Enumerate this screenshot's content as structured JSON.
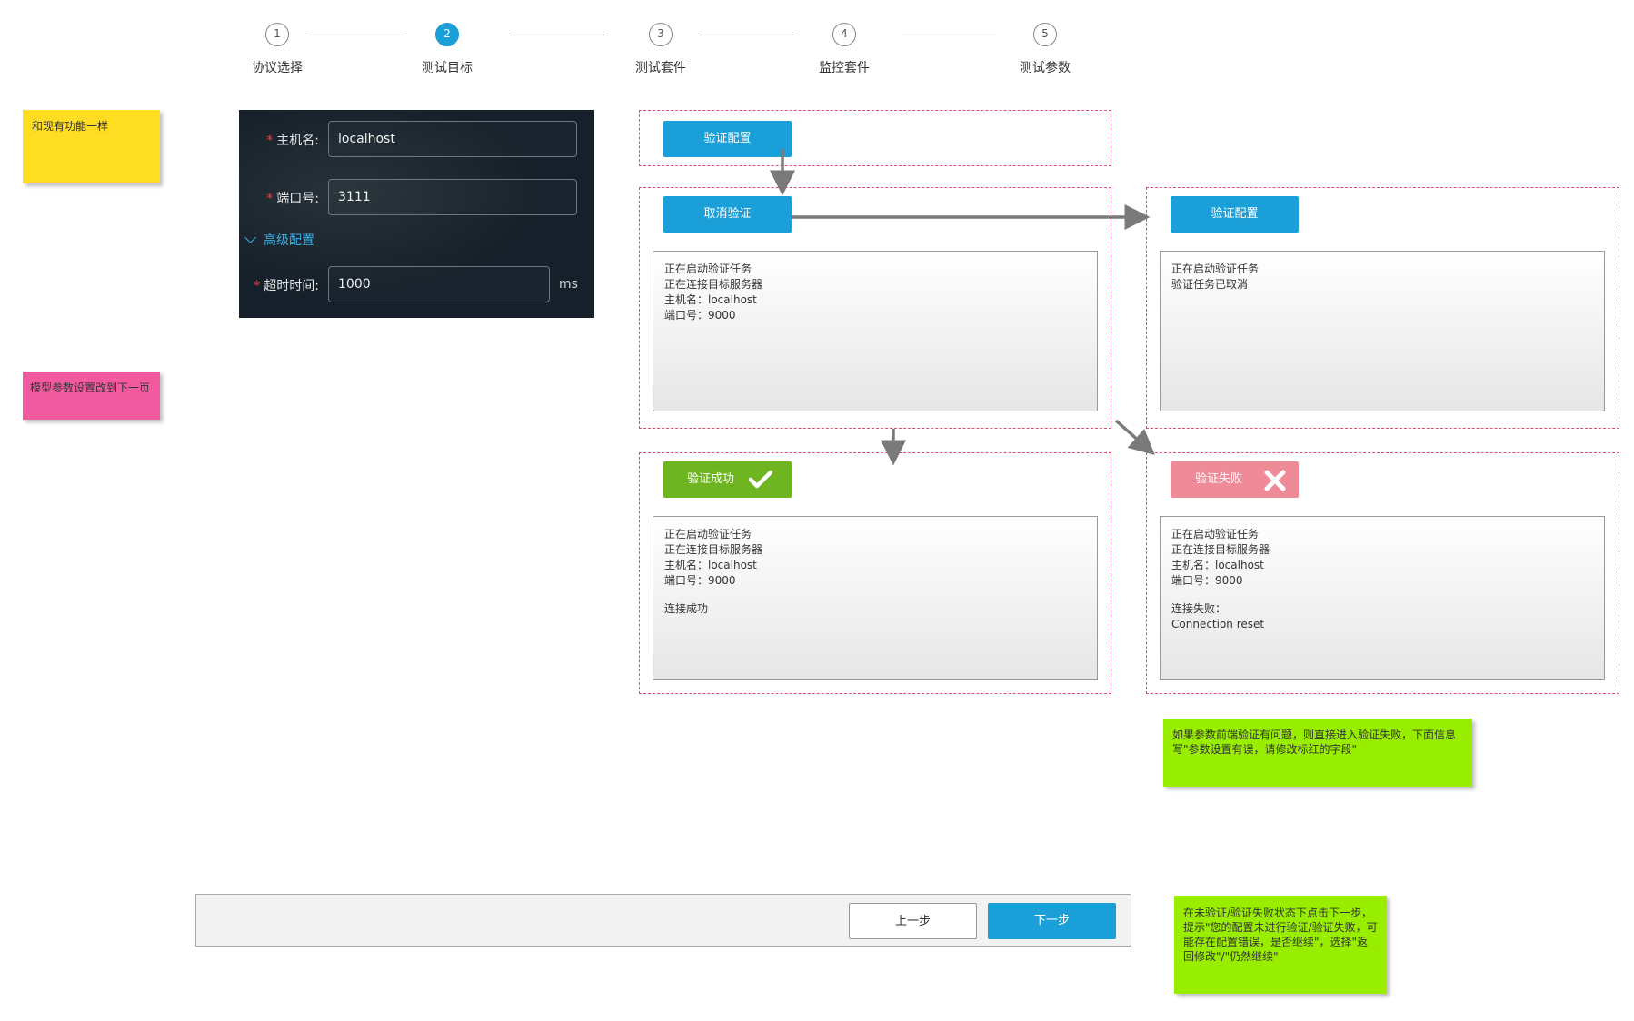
{
  "steps": [
    {
      "num": "1",
      "label": "协议选择",
      "active": false
    },
    {
      "num": "2",
      "label": "测试目标",
      "active": true
    },
    {
      "num": "3",
      "label": "测试套件",
      "active": false
    },
    {
      "num": "4",
      "label": "监控套件",
      "active": false
    },
    {
      "num": "5",
      "label": "测试参数",
      "active": false
    }
  ],
  "notes": {
    "same_as_existing": "和现有功能一样",
    "model_params": "模型参数设置改到下一页",
    "frontend_validation": "如果参数前端验证有问题，则直接进入验证失败，下面信息写\"参数设置有误，请修改标红的字段\"",
    "next_step_prompt": "在未验证/验证失败状态下点击下一步，提示\"您的配置未进行验证/验证失败，可能存在配置错误，是否继续\"，选择\"返回修改\"/\"仍然继续\""
  },
  "form": {
    "host_label": "主机名:",
    "host_value": "localhost",
    "port_label": "端口号:",
    "port_value": "3111",
    "advanced_label": "高级配置",
    "timeout_label": "超时时间:",
    "timeout_value": "1000",
    "timeout_unit": "ms",
    "required_mark": "*"
  },
  "states": {
    "initial_button": "验证配置",
    "validating_button": "取消验证",
    "validating_log": [
      "正在启动验证任务",
      "正在连接目标服务器",
      "主机名：localhost",
      "端口号：9000"
    ],
    "cancelled_button": "验证配置",
    "cancelled_log": [
      "正在启动验证任务",
      "验证任务已取消"
    ],
    "success_button": "验证成功",
    "success_log": [
      "正在启动验证任务",
      "正在连接目标服务器",
      "主机名：localhost",
      "端口号：9000"
    ],
    "success_result": "连接成功",
    "fail_button": "验证失败",
    "fail_log": [
      "正在启动验证任务",
      "正在连接目标服务器",
      "主机名：localhost",
      "端口号：9000"
    ],
    "fail_result_1": "连接失败：",
    "fail_result_2": "Connection reset"
  },
  "nav": {
    "prev": "上一步",
    "next": "下一步"
  },
  "colors": {
    "primary": "#1a9fd9",
    "success": "#6eb521",
    "danger": "#ef8a98",
    "dash": "#e0506a",
    "note_yellow": "#ffdd22",
    "note_pink": "#f25aa0",
    "note_green": "#99ee00"
  }
}
